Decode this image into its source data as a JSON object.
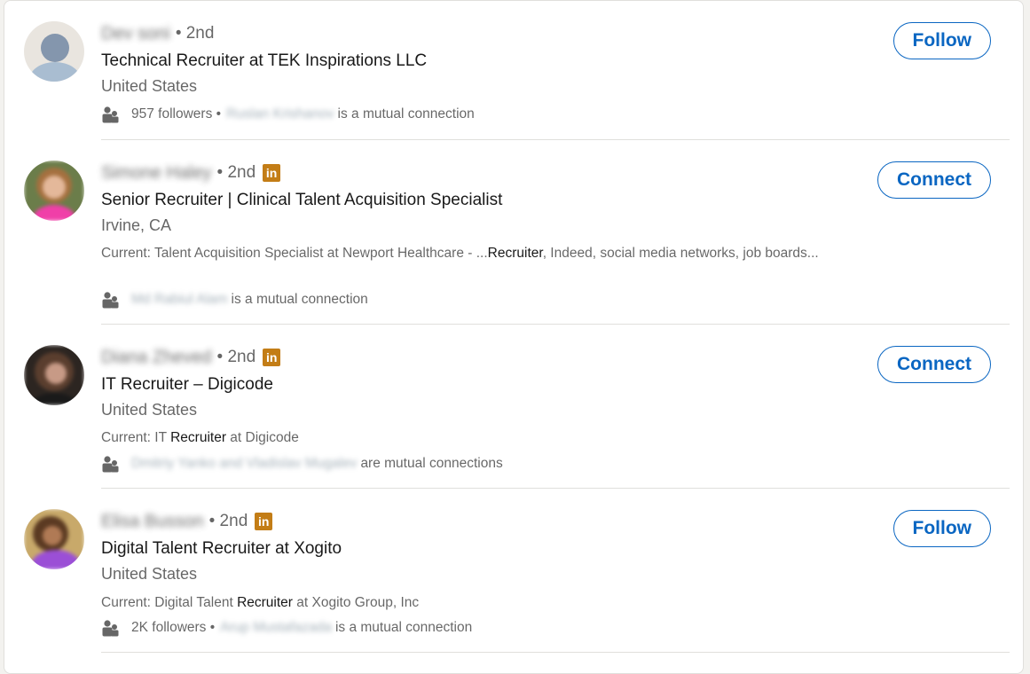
{
  "results": [
    {
      "name": "Dev soni",
      "degree": "• 2nd",
      "premium": false,
      "headline": "Technical Recruiter at TEK Inspirations LLC",
      "location": "United States",
      "summary_prefix": "",
      "summary_highlight": "",
      "summary_suffix": "",
      "followers": "957 followers •",
      "mutual_names": "Ruslan Krishanov",
      "mutual_suffix": "is a mutual connection",
      "action": "Follow"
    },
    {
      "name": "Simone Haley",
      "degree": "• 2nd",
      "premium": true,
      "premium_badge": "in",
      "headline": "Senior Recruiter | Clinical Talent Acquisition Specialist",
      "location": "Irvine, CA",
      "summary_prefix": "Current: Talent Acquisition Specialist at Newport Healthcare - ...",
      "summary_highlight": "Recruiter",
      "summary_suffix": ", Indeed, social media networks, job boards...",
      "followers": "",
      "mutual_names": "Md Rabiul Alam",
      "mutual_suffix": "is a mutual connection",
      "action": "Connect"
    },
    {
      "name": "Diana Zheved",
      "degree": "• 2nd",
      "premium": true,
      "premium_badge": "in",
      "headline": "IT Recruiter – Digicode",
      "location": "United States",
      "summary_prefix": "Current: IT ",
      "summary_highlight": "Recruiter",
      "summary_suffix": " at Digicode",
      "followers": "",
      "mutual_names": "Dmitriy Yanko and Vladislav Mugalev",
      "mutual_suffix": "are mutual connections",
      "action": "Connect"
    },
    {
      "name": "Elisa Busson",
      "degree": "• 2nd",
      "premium": true,
      "premium_badge": "in",
      "headline": "Digital Talent Recruiter at Xogito",
      "location": "United States",
      "summary_prefix": "Current: Digital Talent ",
      "summary_highlight": "Recruiter",
      "summary_suffix": " at Xogito Group, Inc",
      "followers": "2K followers •",
      "mutual_names": "Arup Mustafazada",
      "mutual_suffix": "is a mutual connection",
      "action": "Follow"
    }
  ],
  "colors": {
    "accent": "#0a66c2",
    "premium_badge": "#c37d16",
    "divider": "#e0dfdc"
  },
  "icons": {
    "avatar_default": "default-person-silhouette",
    "mutual": "people-icon",
    "premium": "linkedin-premium-badge"
  }
}
